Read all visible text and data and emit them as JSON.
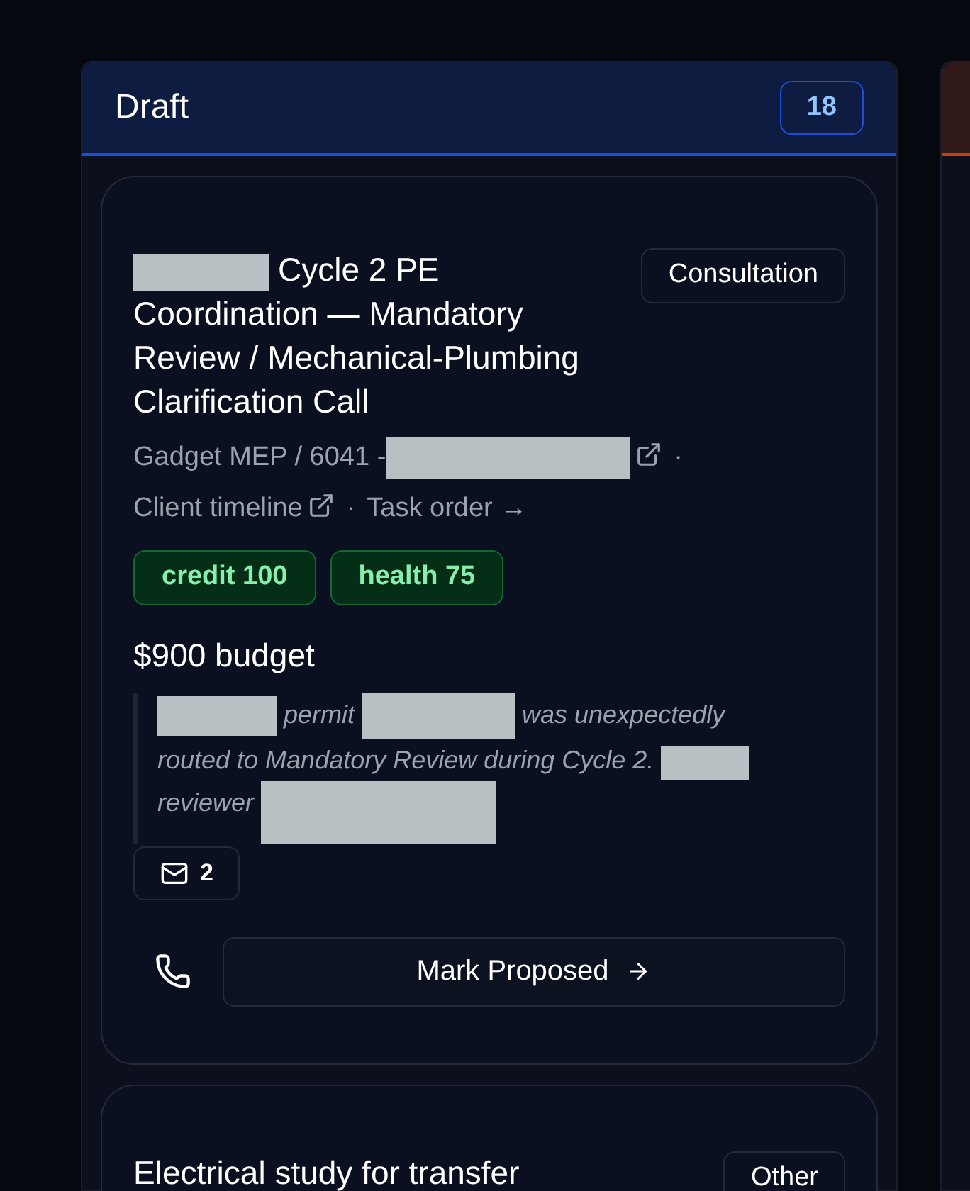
{
  "columns": [
    {
      "title": "Draft",
      "count": "18",
      "color": "#1d4ed8",
      "cards": [
        {
          "title": [
            {
              "kind": "redaction"
            },
            {
              "kind": "text",
              "text": "Cycle 2 PE"
            },
            {
              "kind": "text",
              "text": "Coordination — Mandatory Review / Mechanical-Plumbing Clarification Call"
            }
          ],
          "type_tag": "Consultation",
          "meta": [
            {
              "kind": "text",
              "text": "Gadget MEP / 6041 -"
            },
            {
              "kind": "redaction"
            },
            {
              "kind": "external"
            },
            {
              "kind": "sep",
              "text": "·"
            },
            {
              "kind": "text",
              "text": "Client timeline"
            },
            {
              "kind": "external"
            },
            {
              "kind": "sep",
              "text": "·"
            },
            {
              "kind": "text",
              "text": "Task order →"
            }
          ],
          "tags": [
            {
              "text": "credit 100"
            },
            {
              "text": "health 75"
            }
          ],
          "budget": "$900 budget",
          "note": [
            {
              "kind": "redaction"
            },
            {
              "kind": "text",
              "text": "permit"
            },
            {
              "kind": "redaction"
            },
            {
              "kind": "text",
              "text": "was unexpectedly"
            },
            {
              "kind": "text",
              "text": "routed to Mandatory Review during Cycle 2."
            },
            {
              "kind": "redaction"
            },
            {
              "kind": "text",
              "text": "reviewer"
            },
            {
              "kind": "redaction"
            }
          ],
          "messages": "2",
          "action": "Mark Proposed"
        },
        {
          "title": [
            {
              "kind": "text",
              "text": "Electrical study for transfer"
            }
          ],
          "type_tag": "Other"
        }
      ]
    },
    {
      "color": "#c2410c"
    }
  ]
}
